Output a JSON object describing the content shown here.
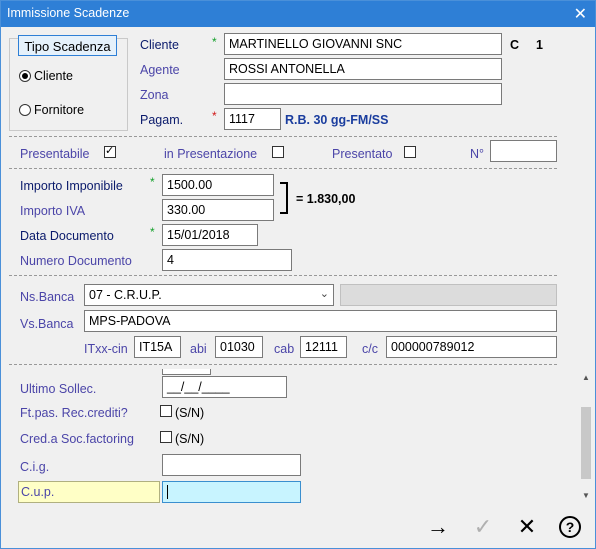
{
  "window": {
    "title": "Immissione Scadenze",
    "close_glyph": "✕"
  },
  "tipo_scadenza": {
    "button_label": "Tipo Scadenza",
    "option_cliente": "Cliente",
    "option_fornitore": "Fornitore",
    "selected": "Cliente"
  },
  "cliente": {
    "label": "Cliente",
    "required_mark": "*",
    "value": "MARTINELLO GIOVANNI SNC",
    "type_code": "C",
    "number": "1"
  },
  "agente": {
    "label": "Agente",
    "value": "ROSSI ANTONELLA"
  },
  "zona": {
    "label": "Zona",
    "value": ""
  },
  "pagamento": {
    "label": "Pagam.",
    "required_mark": "*",
    "code": "1117",
    "description": "R.B. 30 gg-FM/SS"
  },
  "flags": {
    "presentabile_label": "Presentabile",
    "presentabile_checked": true,
    "in_presentazione_label": "in Presentazione",
    "in_presentazione_checked": false,
    "presentato_label": "Presentato",
    "presentato_checked": false,
    "numero_label": "N°",
    "numero_value": ""
  },
  "importi": {
    "imponibile_label": "Importo Imponibile",
    "imponibile_required": "*",
    "imponibile_value": "1500.00",
    "iva_label": "Importo IVA",
    "iva_value": "330.00",
    "total_text": "= 1.830,00"
  },
  "documento": {
    "data_label": "Data Documento",
    "data_required": "*",
    "data_value": "15/01/2018",
    "numero_label": "Numero Documento",
    "numero_value": "4"
  },
  "banca": {
    "ns_label": "Ns.Banca",
    "ns_value": "07 - C.R.U.P.",
    "vs_label": "Vs.Banca",
    "vs_value": "MPS-PADOVA",
    "itxx_label": "ITxx-cin",
    "itxx_value": "IT15A",
    "abi_label": "abi",
    "abi_value": "01030",
    "cab_label": "cab",
    "cab_value": "12111",
    "cc_label": "c/c",
    "cc_value": "000000789012"
  },
  "extra": {
    "ultimo_sollec_label": "Ultimo Sollec.",
    "ultimo_sollec_value": "__/__/____",
    "ft_pas_label": "Ft.pas. Rec.crediti?",
    "ft_pas_yn": "(S/N)",
    "cred_label": "Cred.a Soc.factoring",
    "cred_yn": "(S/N)",
    "cig_label": "C.i.g.",
    "cig_value": "",
    "cup_label": "C.u.p.",
    "cup_value": ""
  },
  "colors": {
    "title_bar": "#2e7fd6",
    "label_blue": "#1a3d9e",
    "required_green": "#13a02a",
    "required_red": "#d01818",
    "highlight_yellow": "#ffffc6",
    "highlight_cyan": "#c8f4ff"
  },
  "toolbar": {
    "next_icon": "→",
    "confirm_icon": "✓",
    "cancel_icon": "✕",
    "help_icon": "?"
  }
}
